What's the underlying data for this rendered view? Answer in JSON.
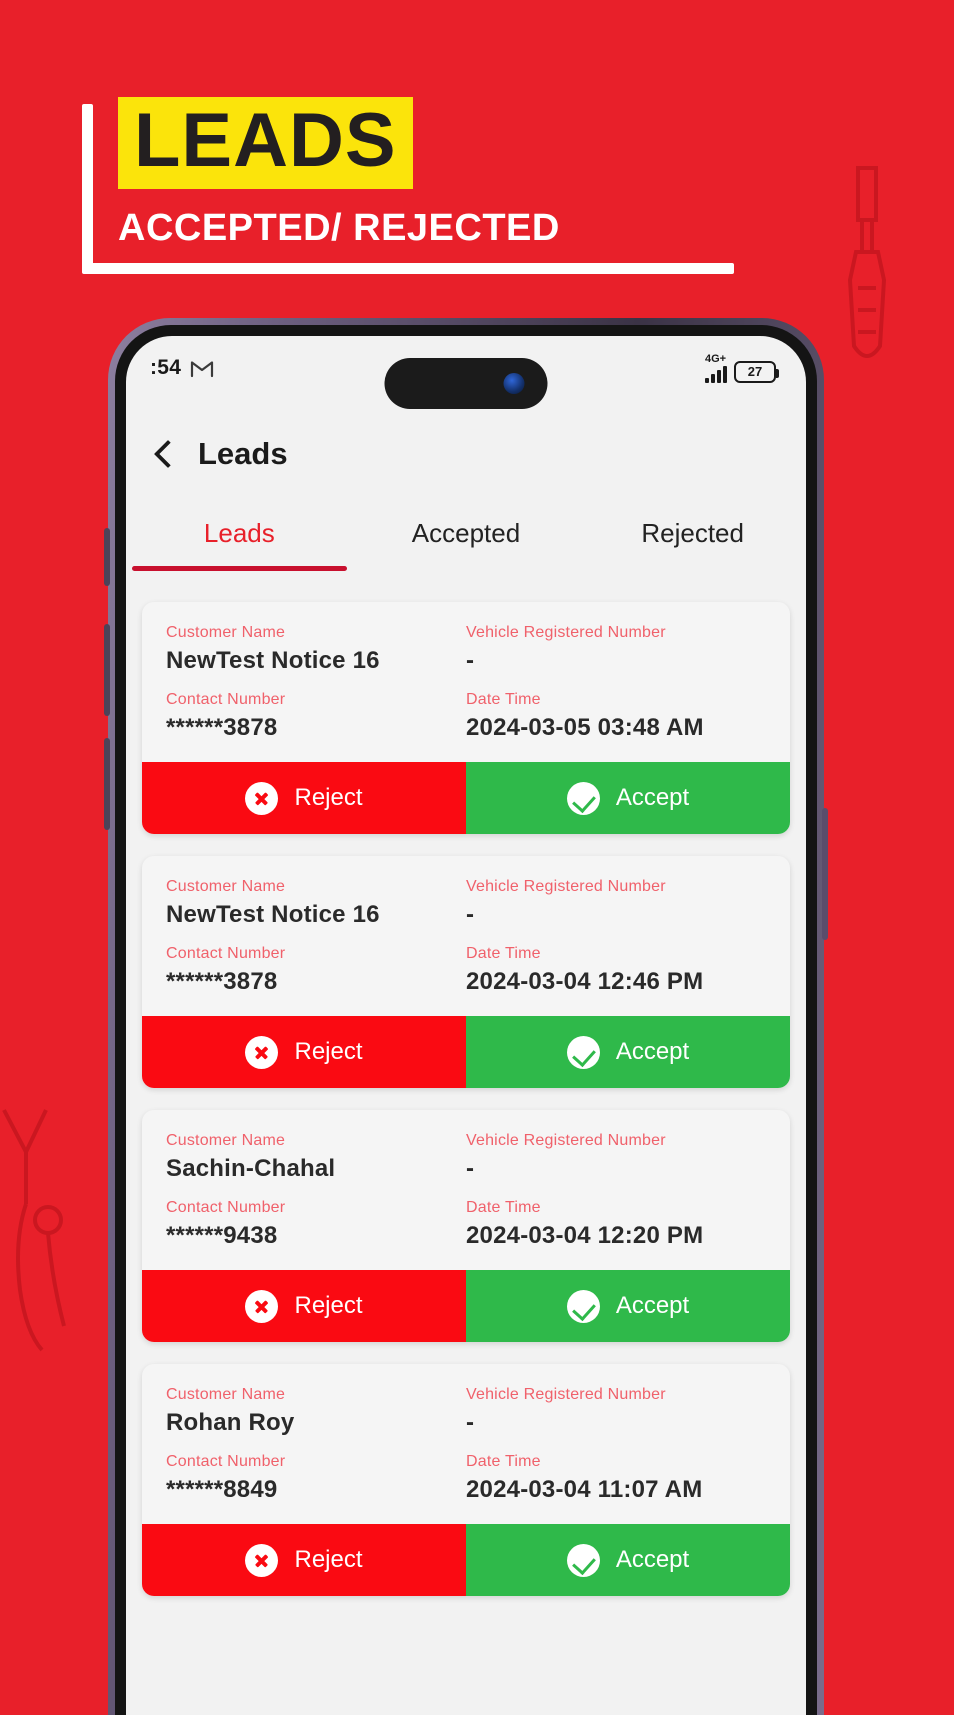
{
  "banner": {
    "title": "LEADS",
    "subtitle": "ACCEPTED/ REJECTED",
    "highlight_color": "#FBE40B",
    "background_color": "#E8202A",
    "title_color": "#231F20",
    "subtitle_color": "#FFFFFF"
  },
  "statusbar": {
    "time": ":54",
    "app_icon": "gmail-icon",
    "network_label": "4G+",
    "signal_icon": "signal-bars-icon",
    "battery_level": "27"
  },
  "appbar": {
    "back_icon": "back-chevron-icon",
    "title": "Leads"
  },
  "tabs": [
    {
      "label": "Leads",
      "active": true
    },
    {
      "label": "Accepted",
      "active": false
    },
    {
      "label": "Rejected",
      "active": false
    }
  ],
  "labels": {
    "customer_name": "Customer Name",
    "vehicle_number": "Vehicle Registered Number",
    "contact_number": "Contact Number",
    "date_time": "Date Time",
    "reject": "Reject",
    "accept": "Accept"
  },
  "colors": {
    "accent_red": "#E8202A",
    "reject_red": "#FA0A12",
    "accept_green": "#2FB94A",
    "label_pink": "#F0616B",
    "tab_active": "#E8202A"
  },
  "leads": [
    {
      "customer_name": "NewTest Notice 16",
      "vehicle_number": "-",
      "contact_number": "******3878",
      "date_time": "2024-03-05 03:48 AM"
    },
    {
      "customer_name": "NewTest Notice 16",
      "vehicle_number": "-",
      "contact_number": "******3878",
      "date_time": "2024-03-04 12:46 PM"
    },
    {
      "customer_name": "Sachin-Chahal",
      "vehicle_number": "-",
      "contact_number": "******9438",
      "date_time": "2024-03-04 12:20 PM"
    },
    {
      "customer_name": "Rohan Roy",
      "vehicle_number": "-",
      "contact_number": "******8849",
      "date_time": "2024-03-04 11:07 AM"
    }
  ]
}
